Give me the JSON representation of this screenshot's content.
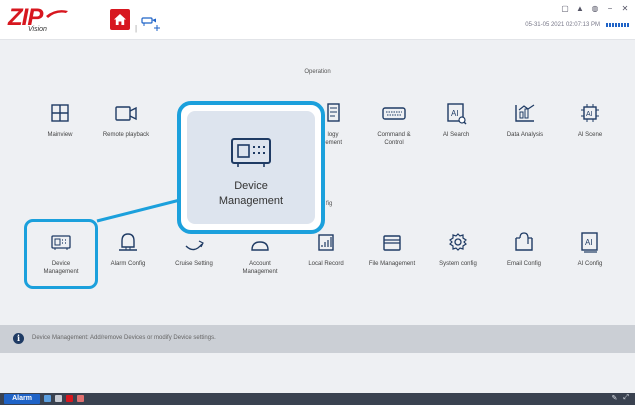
{
  "app": {
    "logo_text": "ZIP",
    "logo_sub": "Vision",
    "status_text": "05-31-05 2021 02:07:13 PM"
  },
  "window_controls": [
    "▢",
    "▲",
    "◍",
    "−",
    "✕"
  ],
  "sections": {
    "operation": "Operation",
    "config": "fig"
  },
  "operation_items": [
    {
      "label": "Mainview",
      "icon": "grid-icon"
    },
    {
      "label": "Remote playback",
      "icon": "video-playback-icon"
    },
    {
      "label": "logy\nlement",
      "icon": "document-icon"
    },
    {
      "label": "Command &\nControl",
      "icon": "keyboard-icon"
    },
    {
      "label": "AI Search",
      "icon": "ai-search-icon"
    },
    {
      "label": "Data Analysis",
      "icon": "data-analysis-icon"
    },
    {
      "label": "AI Scene",
      "icon": "ai-scene-icon"
    }
  ],
  "config_items": [
    {
      "label": "Device\nManagement",
      "icon": "device-icon"
    },
    {
      "label": "Alarm Config",
      "icon": "alarm-bell-icon"
    },
    {
      "label": "Cruise Setting",
      "icon": "cruise-icon"
    },
    {
      "label": "Account\nManagement",
      "icon": "account-icon"
    },
    {
      "label": "Local Record",
      "icon": "local-record-icon"
    },
    {
      "label": "File Management",
      "icon": "folder-icon"
    },
    {
      "label": "System config",
      "icon": "gear-icon"
    },
    {
      "label": "Email Config",
      "icon": "email-icon"
    },
    {
      "label": "AI Config",
      "icon": "ai-config-icon"
    }
  ],
  "callout": {
    "label": "Device\nManagement"
  },
  "info_bar": {
    "text": "Device Management: Add/remove Devices or modify Device settings."
  },
  "bottom_bar": {
    "alarm_label": "Alarm"
  },
  "colors": {
    "brand_red": "#d7171f",
    "highlight_blue": "#1ba0dc",
    "icon_blue": "#1f63c7"
  }
}
